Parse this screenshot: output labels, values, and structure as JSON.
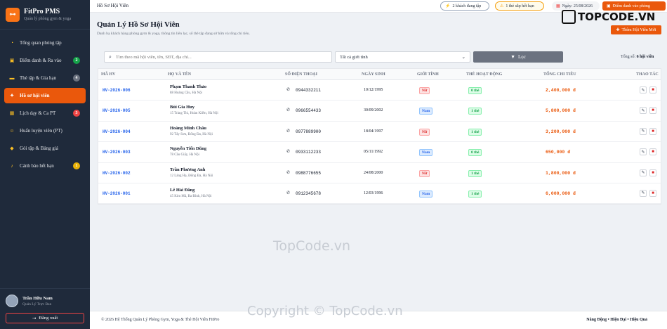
{
  "brand": {
    "title": "FitPro PMS",
    "subtitle": "Quản lý phòng gym & yoga"
  },
  "sidebar": {
    "items": [
      {
        "label": "Tổng quan phòng tập",
        "icon": "gauge-icon",
        "badge": ""
      },
      {
        "label": "Điểm danh & Ra vào",
        "icon": "qr-icon",
        "badge": "2",
        "badge_color": "#16a34a"
      },
      {
        "label": "Thẻ tập & Gia hạn",
        "icon": "card-icon",
        "badge": "4",
        "badge_color": "#6b7280"
      },
      {
        "label": "Hồ sơ hội viên",
        "icon": "users-icon",
        "badge": "",
        "active": true
      },
      {
        "label": "Lịch dạy & Ca PT",
        "icon": "calendar-icon",
        "badge": "3",
        "badge_color": "#ef4444"
      },
      {
        "label": "Huấn luyện viên (PT)",
        "icon": "trainer-icon",
        "badge": ""
      },
      {
        "label": "Gói tập & Bảng giá",
        "icon": "tag-icon",
        "badge": ""
      },
      {
        "label": "Cảnh báo hết hạn",
        "icon": "bell-icon",
        "badge": "1",
        "badge_color": "#eab308"
      }
    ],
    "user": {
      "name": "Trần Hữu Nam",
      "role": "Quản Lý Trực Ban"
    },
    "logout_label": "Đăng xuất"
  },
  "topbar": {
    "title": "Hồ Sơ Hội Viên",
    "active_guests": "2 khách đang tập",
    "expiring_cards": "1 thẻ sắp hết hạn",
    "date": "Ngày: 25/08/2026",
    "checkin_button": "Điểm danh vào phòng"
  },
  "watermark": {
    "logo_text_a": "TOP",
    "logo_text_b": "CODE.VN",
    "center": "TopCode.vn",
    "footer": "Copyright © TopCode.vn"
  },
  "page": {
    "title": "Quản Lý Hồ Sơ Hội Viên",
    "subtitle": "Danh bạ khách hàng phòng gym & yoga, thông tin liên lạc, số thẻ tập đang sở hữu và tổng chi tiêu.",
    "add_button": "Thêm Hội Viên Mới"
  },
  "filters": {
    "search_placeholder": "Tìm theo mã hội viên, tên, SĐT, địa chỉ...",
    "gender_select": "Tất cả giới tính",
    "filter_button": "Lọc",
    "total_label": "Tổng số:",
    "total_value": "6 hội viên"
  },
  "table": {
    "headers": [
      "MÃ HV",
      "HỌ VÀ TÊN",
      "SỐ ĐIỆN THOẠI",
      "NGÀY SINH",
      "GIỚI TÍNH",
      "THẺ HOẠT ĐỘNG",
      "TỔNG CHI TIÊU",
      "THAO TÁC"
    ],
    "rows": [
      {
        "code": "HV-2026-006",
        "name": "Phạm Thanh Thảo",
        "address": "88 Hoàng Cầu, Hà Nội",
        "phone": "0944332211",
        "dob": "10/12/1995",
        "gender": "Nữ",
        "cards": "0 thẻ",
        "spend": "2,400,000 đ"
      },
      {
        "code": "HV-2026-005",
        "name": "Bùi Gia Huy",
        "address": "15 Tràng Thi, Hoàn Kiếm, Hà Nội",
        "phone": "0966554433",
        "dob": "30/09/2002",
        "gender": "Nam",
        "cards": "1 thẻ",
        "spend": "5,800,000 đ"
      },
      {
        "code": "HV-2026-004",
        "name": "Hoàng Minh Châu",
        "address": "92 Tây Sơn, Đống Đa, Hà Nội",
        "phone": "0977889900",
        "dob": "18/04/1997",
        "gender": "Nữ",
        "cards": "1 thẻ",
        "spend": "3,200,000 đ"
      },
      {
        "code": "HV-2026-003",
        "name": "Nguyễn Tiến Dũng",
        "address": "78 Cầu Giấy, Hà Nội",
        "phone": "0933112233",
        "dob": "05/11/1992",
        "gender": "Nam",
        "cards": "0 thẻ",
        "spend": "650,000 đ"
      },
      {
        "code": "HV-2026-002",
        "name": "Trần Phương Anh",
        "address": "12 Láng Hạ, Đống Đa, Hà Nội",
        "phone": "0988776655",
        "dob": "24/08/2000",
        "gender": "Nữ",
        "cards": "1 thẻ",
        "spend": "1,800,000 đ"
      },
      {
        "code": "HV-2026-001",
        "name": "Lê Hải Đăng",
        "address": "45 Kim Mã, Ba Đình, Hà Nội",
        "phone": "0912345678",
        "dob": "12/03/1996",
        "gender": "Nam",
        "cards": "1 thẻ",
        "spend": "6,000,000 đ"
      }
    ]
  },
  "footer": {
    "left": "© 2026 Hệ Thống Quản Lý Phòng Gym, Yoga & Thẻ Hội Viên FitPro",
    "right": "Năng Động • Hiện Đại • Hiệu Quả"
  },
  "colors": {
    "accent": "#ea580c",
    "sidebar": "#1f2a3b",
    "link": "#2563eb"
  }
}
